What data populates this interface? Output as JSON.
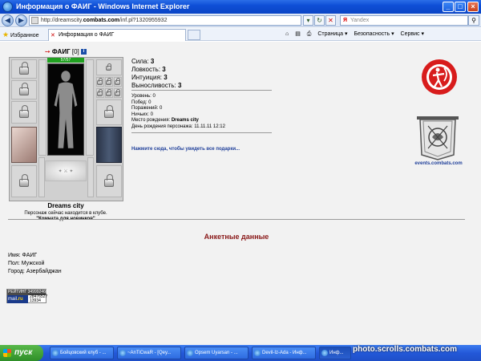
{
  "window": {
    "title": "Информация о ФАИГ - Windows Internet Explorer",
    "buttons": [
      "_",
      "□",
      "×"
    ]
  },
  "address_bar": {
    "url_prefix": "http://dreamscity.",
    "url_domain": "combats.com",
    "url_suffix": "/inf.pl?1320955932",
    "search_placeholder": "Yandex",
    "search_brand": "Я"
  },
  "toolbar": {
    "favorites": "Избранное",
    "tab_title": "Информация о ФАИГ",
    "tools": [
      "Страница ▾",
      "Безопасность ▾",
      "Сервис ▾"
    ]
  },
  "character": {
    "name": "ФАИГ",
    "level": "[0]",
    "hp": "57/57",
    "city": "Dreams city",
    "location_line": "Персонаж сейчас находится в клубе.",
    "location_room": "\"Комната для новичков\""
  },
  "stats": [
    {
      "label": "Сила:",
      "value": "3"
    },
    {
      "label": "Ловкость:",
      "value": "3"
    },
    {
      "label": "Интуиция:",
      "value": "3"
    },
    {
      "label": "Выносливость:",
      "value": "3"
    }
  ],
  "details": [
    {
      "label": "Уровень:",
      "value": "0"
    },
    {
      "label": "Побед:",
      "value": "0"
    },
    {
      "label": "Поражений:",
      "value": "0"
    },
    {
      "label": "Ничьих:",
      "value": "0"
    },
    {
      "label": "Место рождения:",
      "value": "Dreams city"
    },
    {
      "label": "День рождения персонажа:",
      "value": "11.11.11 12:12"
    }
  ],
  "gifts_link": "Нажмите сюда, чтобы увидеть все подарки...",
  "events_link": "events.combats.com",
  "profile": {
    "title": "Анкетные данные",
    "fields": [
      {
        "label": "Имя:",
        "value": "ФАИГ"
      },
      {
        "label": "Пол:",
        "value": "Мужской"
      },
      {
        "label": "Город:",
        "value": "Азербайджан"
      }
    ]
  },
  "rating_badge": {
    "top": "РЕЙТИНГ 349992460",
    "brand": "mail",
    "brand_suffix": ".ru",
    "num1": "28476527",
    "num2": "13934"
  },
  "taskbar": {
    "start": "пуск",
    "tasks": [
      "Бойцовский клуб - ...",
      "~AnTiCwaR - [Qey...",
      "Opsem Uyarsan - ...",
      "Devil-Iz-Ada - Инф...",
      "Инф..."
    ]
  },
  "watermark": "photo.scrolls.combats.com",
  "colors": {
    "accent_red": "#d81c1c",
    "link_blue": "#1f3f9a",
    "profile_title": "#8a1a1a"
  }
}
